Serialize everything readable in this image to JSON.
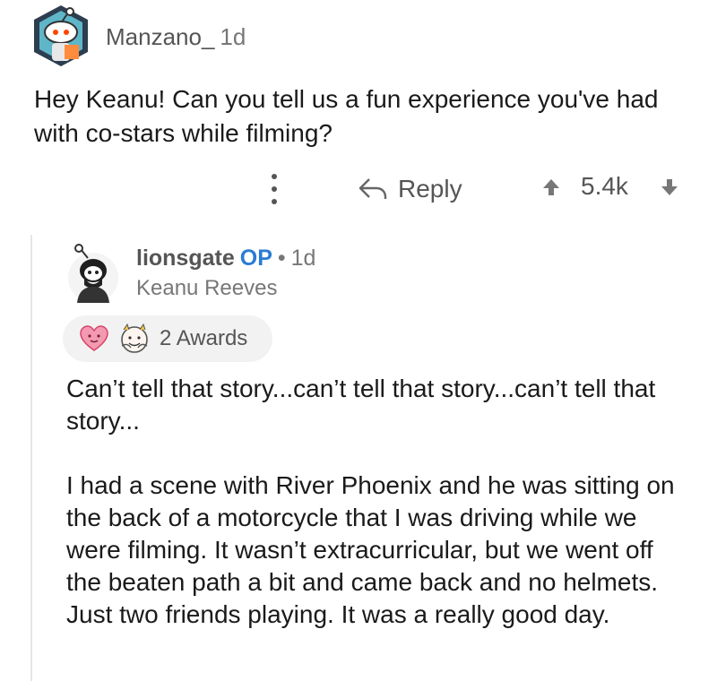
{
  "top_comment": {
    "username": "Manzano_",
    "age": "1d",
    "body": "Hey Keanu! Can you tell us a fun experience you've had with co-stars while filming?",
    "actions": {
      "reply_label": "Reply",
      "score": "5.4k"
    }
  },
  "reply_comment": {
    "username": "lionsgate",
    "op_badge": "OP",
    "separator": "•",
    "age": "1d",
    "flair": "Keanu Reeves",
    "awards_label": "2 Awards",
    "paragraphs": [
      "Can’t tell that story...can’t tell that story...can’t tell that story...",
      "I had a scene with River Phoenix and he was sitting on the back of a motorcycle that I was driving while we were filming. It wasn’t extracurricular, but we went off the beaten path a bit and came back and no helmets. Just two friends playing. It was a really good day."
    ]
  },
  "colors": {
    "op_badge": "#2a7bd4",
    "muted_text": "#555555",
    "awards_pill_bg": "#f2f2f2"
  },
  "icons": {
    "more": "more-vertical-icon",
    "reply": "reply-arrow-icon",
    "upvote": "upvote-arrow-icon",
    "downvote": "downvote-arrow-icon",
    "award_1": "heart-award-icon",
    "award_2": "hug-award-icon"
  }
}
